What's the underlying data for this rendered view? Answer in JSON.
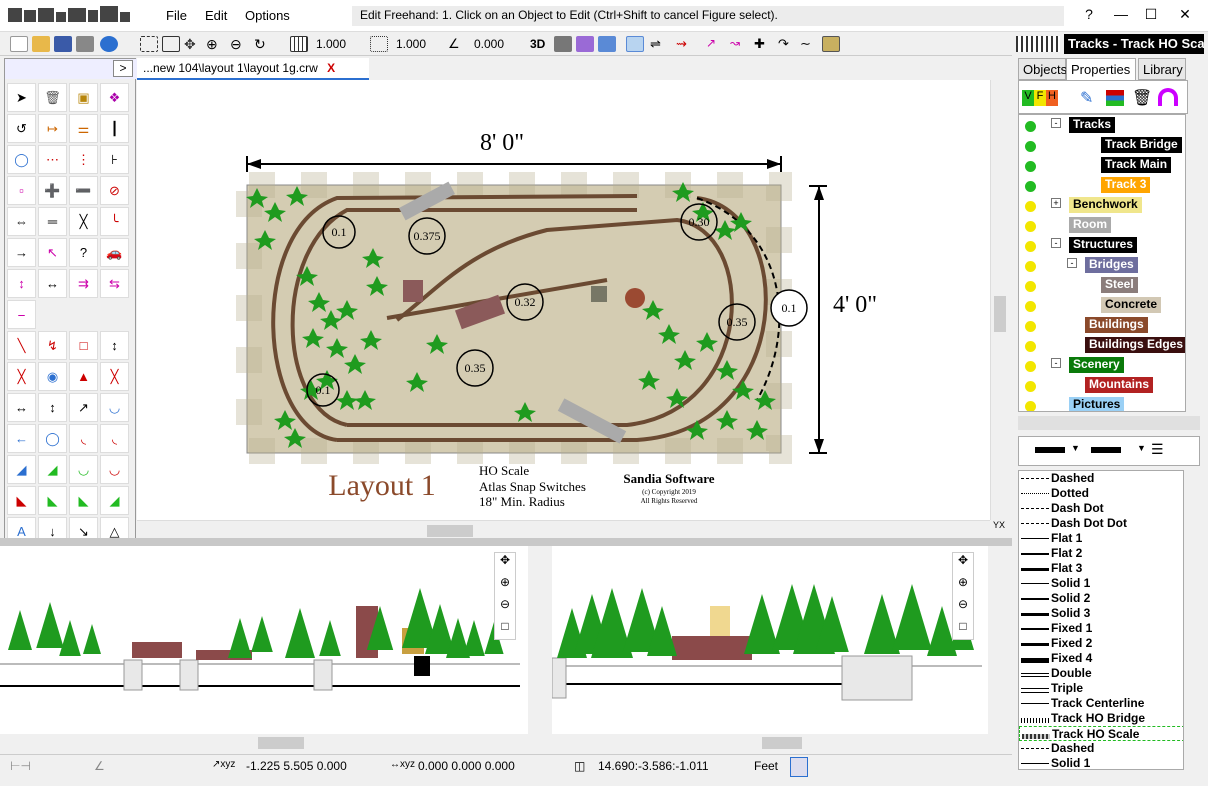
{
  "app": {
    "menus": [
      "File",
      "Edit",
      "Options"
    ],
    "hint": "Edit Freehand:  1. Click on an Object to Edit (Ctrl+Shift to cancel Figure select).",
    "help": "?"
  },
  "toolbar": {
    "grid_value": "1.000",
    "snap_value": "1.000",
    "angle_value": "0.000",
    "three_d": "3D"
  },
  "doc_tab": {
    "label": "...new 104\\layout 1\\layout 1g.crw",
    "close": "X"
  },
  "plan": {
    "width_dim": "8' 0\"",
    "height_dim": "4' 0\"",
    "title": "Layout 1",
    "notes": [
      "HO Scale",
      "Atlas Snap Switches",
      "18\" Min. Radius"
    ],
    "company": "Sandia Software",
    "copyright": "(c) Copyright 2019",
    "rights": "All Rights Reserved",
    "radii": [
      "0.1",
      "0.375",
      "0.30",
      "0.32",
      "0.1",
      "0.35",
      "0.35",
      "0.1"
    ]
  },
  "status": {
    "coords1": "-1.225  5.505  0.000",
    "coords2": "0.000  0.000  0.000",
    "coords3": "14.690:-3.586:-1.011",
    "units": "Feet"
  },
  "right_panel": {
    "title": "Tracks - Track HO Scale",
    "tabs": [
      "Objects",
      "Properties",
      "Library"
    ],
    "vfh": [
      "V",
      "F",
      "H"
    ],
    "tree": [
      {
        "label": "Tracks",
        "lamp": "#22bb22",
        "indent": 0,
        "bg": "#000",
        "fg": "#fff",
        "exp": "-"
      },
      {
        "label": "Track Bridge",
        "lamp": "#22bb22",
        "indent": 2,
        "bg": "#000",
        "fg": "#fff",
        "exp": ""
      },
      {
        "label": "Track Main",
        "lamp": "#22bb22",
        "indent": 2,
        "bg": "#000",
        "fg": "#fff",
        "exp": ""
      },
      {
        "label": "Track 3",
        "lamp": "#22bb22",
        "indent": 2,
        "bg": "#ffa500",
        "fg": "#fff",
        "exp": ""
      },
      {
        "label": "Benchwork",
        "lamp": "#f2e600",
        "indent": 0,
        "bg": "#f0e68c",
        "fg": "#000",
        "exp": "+"
      },
      {
        "label": "Room",
        "lamp": "#f2e600",
        "indent": 0,
        "bg": "#aaa",
        "fg": "#fff",
        "exp": ""
      },
      {
        "label": "Structures",
        "lamp": "#f2e600",
        "indent": 0,
        "bg": "#000",
        "fg": "#fff",
        "exp": "-"
      },
      {
        "label": "Bridges",
        "lamp": "#f2e600",
        "indent": 1,
        "bg": "#6e6e9e",
        "fg": "#fff",
        "exp": "-"
      },
      {
        "label": "Steel",
        "lamp": "#f2e600",
        "indent": 2,
        "bg": "#8b7d7b",
        "fg": "#fff",
        "exp": ""
      },
      {
        "label": "Concrete",
        "lamp": "#f2e600",
        "indent": 2,
        "bg": "#d2c8b4",
        "fg": "#000",
        "exp": ""
      },
      {
        "label": "Buildings",
        "lamp": "#f2e600",
        "indent": 1,
        "bg": "#8b4a2b",
        "fg": "#fff",
        "exp": ""
      },
      {
        "label": "Buildings Edges",
        "lamp": "#f2e600",
        "indent": 1,
        "bg": "#3a0f0f",
        "fg": "#fff",
        "exp": ""
      },
      {
        "label": "Scenery",
        "lamp": "#f2e600",
        "indent": 0,
        "bg": "#0a7a0a",
        "fg": "#fff",
        "exp": "-"
      },
      {
        "label": "Mountains",
        "lamp": "#f2e600",
        "indent": 1,
        "bg": "#b22222",
        "fg": "#fff",
        "exp": ""
      },
      {
        "label": "Pictures",
        "lamp": "#f2e600",
        "indent": 0,
        "bg": "#9ad0f5",
        "fg": "#000",
        "exp": ""
      }
    ],
    "linestyles": [
      "Dashed",
      "Dotted",
      "Dash Dot",
      "Dash Dot Dot",
      "Flat 1",
      "Flat 2",
      "Flat 3",
      "Solid 1",
      "Solid 2",
      "Solid 3",
      "Fixed 1",
      "Fixed 2",
      "Fixed 4",
      "Double",
      "Triple",
      "Track Centerline",
      "Track HO Bridge",
      "Track HO Scale",
      "Dashed",
      "Solid 1"
    ]
  }
}
